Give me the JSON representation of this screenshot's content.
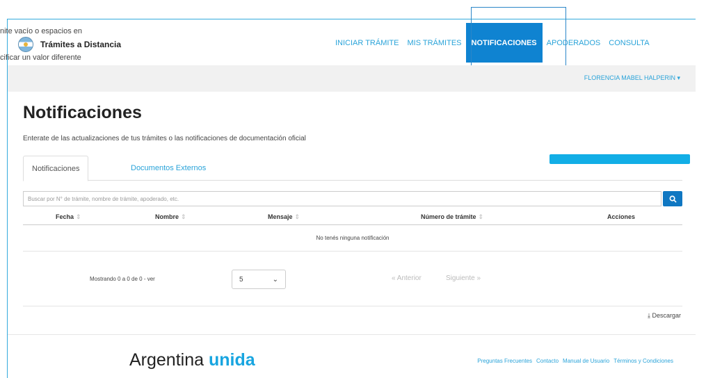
{
  "header": {
    "ghost_line_1": "nite vacío o espacios en",
    "ghost_line_2": "cificar un valor diferente",
    "logo_text": "Trámites a Distancia",
    "nav": [
      {
        "label": "INICIAR TRÁMITE",
        "active": false
      },
      {
        "label": "MIS TRÁMITES",
        "active": false
      },
      {
        "label": "NOTIFICACIONES",
        "active": true
      },
      {
        "label": "APODERADOS",
        "active": false
      },
      {
        "label": "CONSULTA",
        "active": false
      }
    ]
  },
  "userbar": {
    "user_name": "FLORENCIA MABEL HALPERIN ▾"
  },
  "main": {
    "title": "Notificaciones",
    "subtitle": "Enterate de las actualizaciones de tus trámites o las notificaciones de documentación oficial",
    "tabs": [
      {
        "label": "Notificaciones",
        "active": true
      },
      {
        "label": "Documentos Externos",
        "active": false
      }
    ],
    "search": {
      "placeholder": "Buscar por N° de trámite, nombre de trámite, apoderado, etc."
    },
    "table": {
      "headers": [
        "Fecha",
        "Nombre",
        "Mensaje",
        "Número de trámite",
        "Acciones"
      ],
      "empty_message": "No tenés ninguna notificación"
    },
    "pagination": {
      "showing": "Mostrando 0 a 0 de 0 - ver",
      "page_size": "5",
      "prev": "« Anterior",
      "next": "Siguiente »"
    },
    "download": "⤓ Descargar"
  },
  "footer": {
    "brand_main": "Argentina",
    "brand_accent": "unida",
    "links": [
      "Preguntas Frecuentes",
      "Contacto",
      "Manual de Usuario",
      "Términos y Condiciones"
    ]
  },
  "colors": {
    "accent": "#29a3d9",
    "nav_active_bg": "#0f83d1",
    "search_button": "#0f77c2",
    "highlight_bar": "#12aee6"
  }
}
